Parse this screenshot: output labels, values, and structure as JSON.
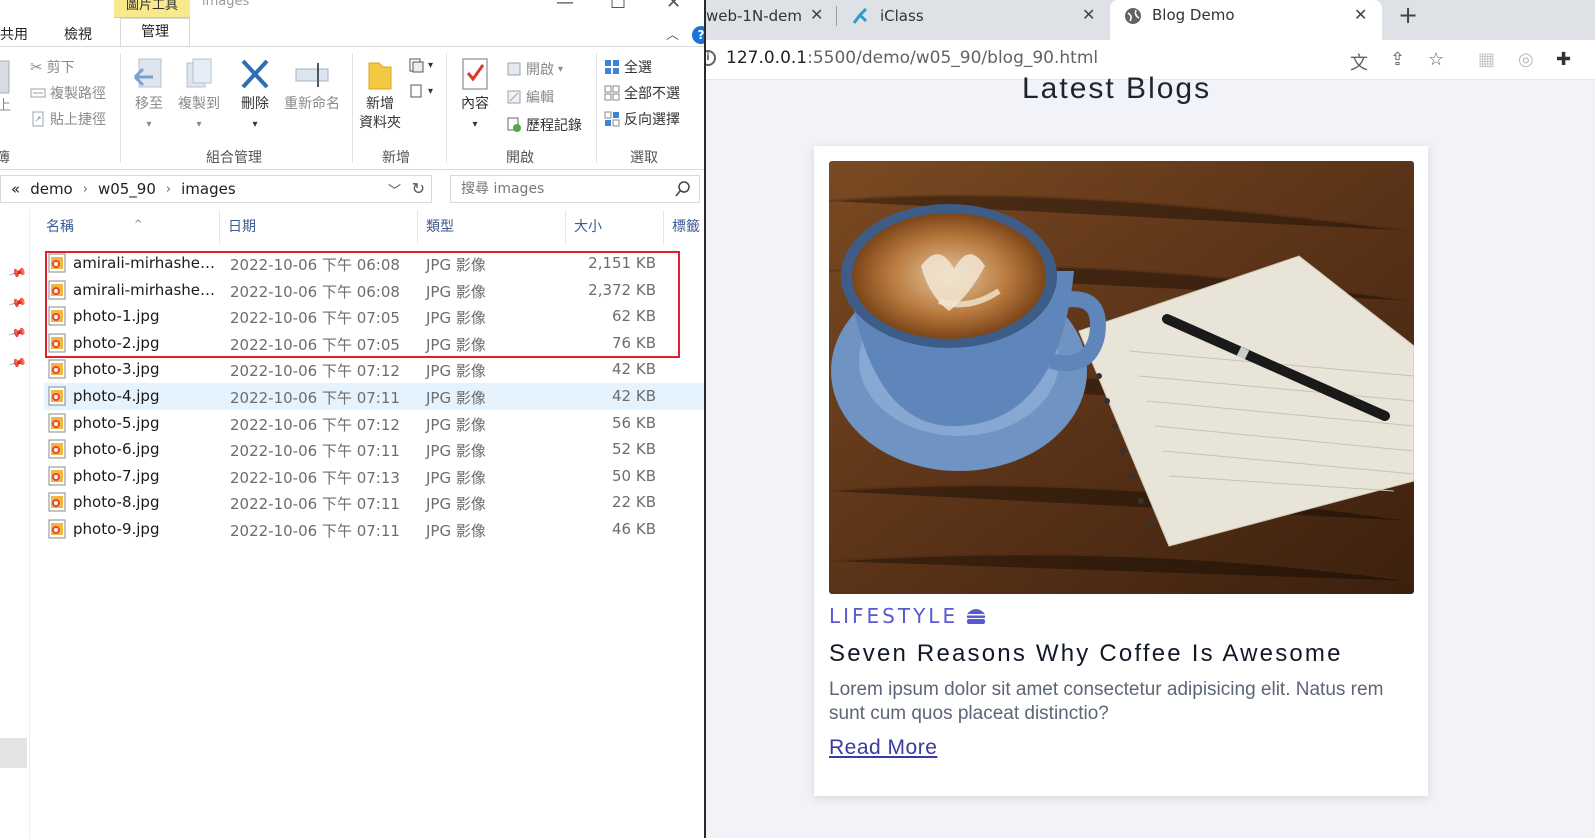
{
  "explorer": {
    "context_tab": "圖片工具",
    "window_title": "images",
    "ribbon_tabs": {
      "share": "共用",
      "view": "檢視",
      "manage": "管理"
    },
    "ribbon": {
      "clipboard": {
        "cut": "剪下",
        "copy_path": "複製路徑",
        "paste_shortcut": "貼上捷徑",
        "paste_partial": "上",
        "group_partial": "簿"
      },
      "organize": {
        "move_to": "移至",
        "copy_to": "複製到",
        "delete": "刪除",
        "rename": "重新命名",
        "label": "組合管理"
      },
      "new": {
        "new_folder_line1": "新增",
        "new_folder_line2": "資料夾",
        "label": "新增"
      },
      "open": {
        "properties": "內容",
        "open": "開啟",
        "edit": "編輯",
        "history": "歷程記錄",
        "label": "開啟"
      },
      "select": {
        "select_all": "全選",
        "select_none": "全部不選",
        "invert": "反向選擇",
        "label": "選取"
      }
    },
    "address": {
      "prefix": "«",
      "crumbs": [
        "demo",
        "w05_90",
        "images"
      ]
    },
    "search": {
      "placeholder": "搜尋 images"
    },
    "columns": {
      "name": "名稱",
      "date": "日期",
      "type": "類型",
      "size": "大小",
      "tags": "標籤"
    },
    "files": [
      {
        "name": "amirali-mirhashem...",
        "date": "2022-10-06 下午 06:08",
        "type": "JPG 影像",
        "size": "2,151 KB"
      },
      {
        "name": "amirali-mirhashem...",
        "date": "2022-10-06 下午 06:08",
        "type": "JPG 影像",
        "size": "2,372 KB"
      },
      {
        "name": "photo-1.jpg",
        "date": "2022-10-06 下午 07:05",
        "type": "JPG 影像",
        "size": "62 KB"
      },
      {
        "name": "photo-2.jpg",
        "date": "2022-10-06 下午 07:05",
        "type": "JPG 影像",
        "size": "76 KB"
      },
      {
        "name": "photo-3.jpg",
        "date": "2022-10-06 下午 07:12",
        "type": "JPG 影像",
        "size": "42 KB"
      },
      {
        "name": "photo-4.jpg",
        "date": "2022-10-06 下午 07:11",
        "type": "JPG 影像",
        "size": "42 KB"
      },
      {
        "name": "photo-5.jpg",
        "date": "2022-10-06 下午 07:12",
        "type": "JPG 影像",
        "size": "56 KB"
      },
      {
        "name": "photo-6.jpg",
        "date": "2022-10-06 下午 07:11",
        "type": "JPG 影像",
        "size": "52 KB"
      },
      {
        "name": "photo-7.jpg",
        "date": "2022-10-06 下午 07:13",
        "type": "JPG 影像",
        "size": "50 KB"
      },
      {
        "name": "photo-8.jpg",
        "date": "2022-10-06 下午 07:11",
        "type": "JPG 影像",
        "size": "22 KB"
      },
      {
        "name": "photo-9.jpg",
        "date": "2022-10-06 下午 07:11",
        "type": "JPG 影像",
        "size": "46 KB"
      }
    ],
    "selected_row": 5,
    "highlight_color": "#e0202a"
  },
  "browser": {
    "tabs": [
      {
        "title": "web-1N-dem",
        "icon": "page-icon"
      },
      {
        "title": "iClass",
        "icon": "iclass-icon"
      },
      {
        "title": "Blog Demo",
        "icon": "globe-icon"
      }
    ],
    "url": {
      "host": "127.0.0.1",
      "path": ":5500/demo/w05_90/blog_90.html"
    },
    "page": {
      "heading": "Latest Blogs",
      "card": {
        "category": "LIFESTYLE",
        "category_icon": "burger-icon",
        "title": "Seven Reasons Why Coffee Is Awesome",
        "excerpt": "Lorem ipsum dolor sit amet consectetur adipisicing elit. Natus rem sunt cum quos placeat distinctio?",
        "read_more": "Read More",
        "image_icon": "coffee-notebook-photo"
      }
    },
    "colors": {
      "accent": "#5a5ad0",
      "link": "#3b3b9e",
      "page_bg": "#f1f3f8"
    }
  }
}
